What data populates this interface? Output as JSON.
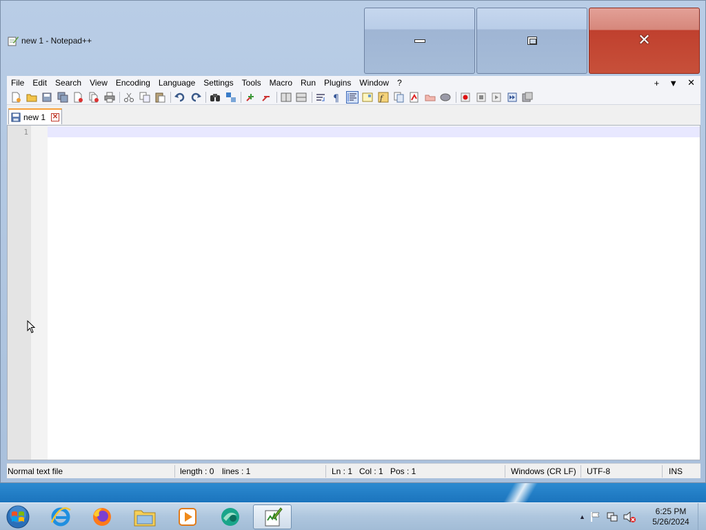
{
  "window": {
    "title": "new 1 - Notepad++"
  },
  "menubar": {
    "items": [
      "File",
      "Edit",
      "Search",
      "View",
      "Encoding",
      "Language",
      "Settings",
      "Tools",
      "Macro",
      "Run",
      "Plugins",
      "Window",
      "?"
    ],
    "right": {
      "plus": "+",
      "dropdown": "▼",
      "close": "✕"
    }
  },
  "toolbar": {
    "buttons": [
      "new-file",
      "open-file",
      "save",
      "save-all",
      "close",
      "close-all",
      "print",
      "cut",
      "copy",
      "paste",
      "undo",
      "redo",
      "find",
      "replace",
      "zoom-in",
      "zoom-out",
      "sync-vertical",
      "sync-horizontal",
      "word-wrap",
      "show-all-chars",
      "indent-guide",
      "doc-map",
      "function-list",
      "folder-as-workspace",
      "monitor",
      "bookmark",
      "record-macro",
      "stop-macro",
      "play-macro",
      "run-macro-multiple",
      "save-macro"
    ]
  },
  "tabs": [
    {
      "label": "new 1",
      "close": "✕"
    }
  ],
  "editor": {
    "line_numbers": [
      "1"
    ]
  },
  "statusbar": {
    "file_type": "Normal text file",
    "length": "length : 0",
    "lines": "lines : 1",
    "ln": "Ln : 1",
    "col": "Col : 1",
    "pos": "Pos : 1",
    "eol": "Windows (CR LF)",
    "encoding": "UTF-8",
    "mode": "INS"
  },
  "taskbar": {
    "apps": [
      "internet-explorer",
      "firefox",
      "file-explorer",
      "media-player",
      "browser-app",
      "notepad-plus-plus"
    ],
    "tray_arrow": "▲",
    "clock_time": "6:25 PM",
    "clock_date": "5/26/2024"
  },
  "colors": {
    "close_button": "#c7503a",
    "title_bar": "#b9cde6",
    "current_line": "#e8e8ff",
    "tab_accent": "#f7a03a"
  }
}
